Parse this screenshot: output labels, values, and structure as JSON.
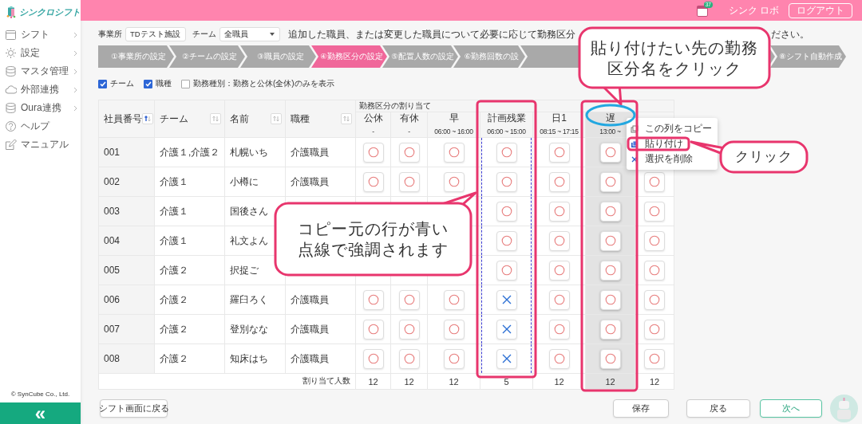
{
  "app": {
    "logo": "シンクロシフト"
  },
  "sidebar": {
    "items": [
      {
        "label": "シフト",
        "has_submenu": true
      },
      {
        "label": "設定",
        "has_submenu": true
      },
      {
        "label": "マスタ管理",
        "has_submenu": true
      },
      {
        "label": "外部連携",
        "has_submenu": true
      },
      {
        "label": "Oura連携",
        "has_submenu": true
      },
      {
        "label": "ヘルプ",
        "has_submenu": false
      },
      {
        "label": "マニュアル",
        "has_submenu": false
      }
    ],
    "copyright": "© SynCube Co., Ltd.",
    "collapse_label": "«"
  },
  "header": {
    "notification_count": "37",
    "user": "シンク ロボ",
    "logout": "ログアウト"
  },
  "filters": [
    {
      "label": "事業所",
      "value": "TDテスト施設"
    },
    {
      "label": "チーム",
      "value": "全職員"
    }
  ],
  "message": [
    "追加した職員、または変更した職員について必要に応じて勤務区分",
    "ださい。"
  ],
  "steps": [
    {
      "label": "①事業所の設定",
      "selected": false
    },
    {
      "label": "②チームの設定",
      "selected": false
    },
    {
      "label": "③職員の設定",
      "selected": false
    },
    {
      "label": "④勤務区分の設定",
      "selected": true
    },
    {
      "label": "⑤配置人数の設定",
      "selected": false
    },
    {
      "label": "⑥勤務回数の設",
      "selected": false
    },
    {
      "label": "⑧シフト自動作成",
      "selected": false
    }
  ],
  "options": [
    {
      "label": "チーム",
      "checked": true
    },
    {
      "label": "職種",
      "checked": true
    },
    {
      "label": "勤務種別：勤務と公休(全休)のみを表示",
      "checked": false
    }
  ],
  "table": {
    "columns": [
      {
        "label": "社員番号",
        "sorted": true
      },
      {
        "label": "チーム",
        "sorted": false
      },
      {
        "label": "名前",
        "sorted": false
      },
      {
        "label": "職種",
        "sorted": false
      }
    ],
    "group_header": "勤務区分の割り当て",
    "shift_columns": [
      {
        "name": "公休",
        "time": "-",
        "selected": false
      },
      {
        "name": "有休",
        "time": "-",
        "selected": false
      },
      {
        "name": "早",
        "time": "06:00 ~ 16:00",
        "selected": false
      },
      {
        "name": "計画残業",
        "time": "06:00 ~ 15:00",
        "selected": false,
        "copy_source": true
      },
      {
        "name": "日1",
        "time": "08:15 ~ 17:15",
        "selected": false
      },
      {
        "name": "遅",
        "time": "13:00 ~",
        "selected": true
      },
      {}
    ],
    "rows": [
      {
        "id": "001",
        "team": "介護１,介護２",
        "name": "札幌いち",
        "job": "介護職員",
        "cells": [
          {
            "assigned": true
          },
          {
            "assigned": true
          },
          {
            "assigned": true
          },
          {
            "assigned": true
          },
          {
            "assigned": true
          },
          {
            "assigned": true
          },
          {}
        ]
      },
      {
        "id": "002",
        "team": "介護１",
        "name": "小樽に",
        "job": "介護職員",
        "cells": [
          {
            "assigned": true
          },
          {
            "assigned": true
          },
          {
            "assigned": true
          },
          {
            "assigned": true
          },
          {
            "assigned": true
          },
          {
            "assigned": true
          },
          {
            "assigned": true
          }
        ]
      },
      {
        "id": "003",
        "team": "介護１",
        "name": "国後さん",
        "cells": [
          {},
          {},
          {},
          {
            "assigned": true
          },
          {
            "assigned": true
          },
          {
            "assigned": true
          },
          {
            "assigned": true
          }
        ]
      },
      {
        "id": "004",
        "team": "介護１",
        "name": "礼文よん",
        "cells": [
          {},
          {},
          {},
          {
            "assigned": true
          },
          {
            "assigned": true
          },
          {
            "assigned": true
          },
          {
            "assigned": true
          }
        ]
      },
      {
        "id": "005",
        "team": "介護２",
        "name": "択捉ご",
        "cells": [
          {},
          {},
          {},
          {
            "assigned": true
          },
          {
            "assigned": true
          },
          {
            "assigned": true
          },
          {
            "assigned": true
          }
        ]
      },
      {
        "id": "006",
        "team": "介護２",
        "name": "羅臼ろく",
        "job": "介護職員",
        "cells": [
          {
            "assigned": true
          },
          {
            "assigned": true
          },
          {
            "assigned": true
          },
          {
            "assigned": false
          },
          {
            "assigned": true
          },
          {
            "assigned": true
          },
          {
            "assigned": true
          }
        ]
      },
      {
        "id": "007",
        "team": "介護２",
        "name": "登別なな",
        "job": "介護職員",
        "cells": [
          {
            "assigned": true
          },
          {
            "assigned": true
          },
          {
            "assigned": true
          },
          {
            "assigned": false
          },
          {
            "assigned": true
          },
          {
            "assigned": true
          },
          {
            "assigned": true
          }
        ]
      },
      {
        "id": "008",
        "team": "介護２",
        "name": "知床はち",
        "job": "介護職員",
        "cells": [
          {
            "assigned": true
          },
          {
            "assigned": true
          },
          {
            "assigned": true
          },
          {
            "assigned": false
          },
          {
            "assigned": true
          },
          {
            "assigned": true
          },
          {
            "assigned": true
          }
        ]
      }
    ],
    "totals_label": "割り当て人数",
    "totals": [
      "12",
      "12",
      "12",
      "5",
      "12",
      "12",
      "12"
    ]
  },
  "context_menu": {
    "items": [
      {
        "label": "この列をコピー"
      },
      {
        "label": "貼り付け"
      },
      {
        "label": "選択を削除"
      }
    ]
  },
  "buttons": {
    "back_to_shift": "シフト画面に戻る",
    "save": "保存",
    "back": "戻る",
    "next": "次へ"
  },
  "annotations": [
    {
      "kind": "callout",
      "text": "貼り付けたい先の勤務区分名をクリック"
    },
    {
      "kind": "callout",
      "text": "コピー元の行が青い点線で強調されます"
    },
    {
      "kind": "callout",
      "text": "クリック"
    },
    {
      "kind": "frame"
    },
    {
      "kind": "frame"
    },
    {
      "kind": "frame"
    },
    {
      "kind": "ellipse"
    }
  ]
}
